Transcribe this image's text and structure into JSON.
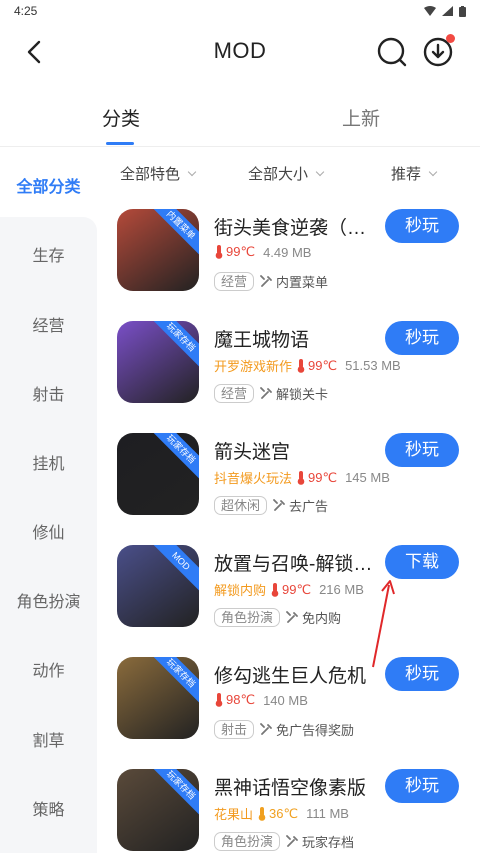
{
  "status_bar": {
    "time": "4:25"
  },
  "header": {
    "title": "MOD"
  },
  "tabs": [
    {
      "label": "分类",
      "active": true
    },
    {
      "label": "上新",
      "active": false
    }
  ],
  "sidebar": {
    "items": [
      {
        "label": "全部分类",
        "active": true
      },
      {
        "label": "生存"
      },
      {
        "label": "经营"
      },
      {
        "label": "射击"
      },
      {
        "label": "挂机"
      },
      {
        "label": "修仙"
      },
      {
        "label": "角色扮演"
      },
      {
        "label": "动作"
      },
      {
        "label": "割草"
      },
      {
        "label": "策略"
      }
    ]
  },
  "filters": [
    {
      "label": "全部特色"
    },
    {
      "label": "全部大小"
    },
    {
      "label": "推荐"
    }
  ],
  "apps": [
    {
      "name": "街头美食逆袭（内置菜单）",
      "promo": "",
      "heat": "99℃",
      "heat_level": "hot",
      "size": "4.49 MB",
      "category": "经营",
      "feature": "内置菜单",
      "button": "秒玩",
      "ribbon": "内置菜单",
      "icon_color": "#b54a3a"
    },
    {
      "name": "魔王城物语",
      "promo": "开罗游戏新作",
      "heat": "99℃",
      "heat_level": "hot",
      "size": "51.53 MB",
      "category": "经营",
      "feature": "解锁关卡",
      "button": "秒玩",
      "ribbon": "玩家存档",
      "icon_color": "#7a4fc8"
    },
    {
      "name": "箭头迷宫",
      "promo": "抖音爆火玩法",
      "heat": "99℃",
      "heat_level": "hot",
      "size": "145 MB",
      "category": "超休闲",
      "feature": "去广告",
      "button": "秒玩",
      "ribbon": "玩家存档",
      "icon_color": "#1e1e22"
    },
    {
      "name": "放置与召唤-解锁内购",
      "promo": "解锁内购",
      "heat": "99℃",
      "heat_level": "hot",
      "size": "216 MB",
      "category": "角色扮演",
      "feature": "免内购",
      "button": "下载",
      "ribbon": "MOD",
      "icon_color": "#4a4f8a"
    },
    {
      "name": "修勾逃生巨人危机",
      "promo": "",
      "heat": "98℃",
      "heat_level": "hot",
      "size": "140 MB",
      "category": "射击",
      "feature": "免广告得奖励",
      "button": "秒玩",
      "ribbon": "玩家存档",
      "icon_color": "#8a6b3c"
    },
    {
      "name": "黑神话悟空像素版",
      "promo": "花果山",
      "heat": "36℃",
      "heat_level": "mild",
      "size": "111 MB",
      "category": "角色扮演",
      "feature": "玩家存档",
      "button": "秒玩",
      "ribbon": "玩家存档",
      "icon_color": "#5a4a3a"
    }
  ],
  "colors": {
    "accent": "#2f7cf6",
    "hot": "#e8463a",
    "promo": "#f39a1e",
    "annotation": "#e0282a"
  }
}
